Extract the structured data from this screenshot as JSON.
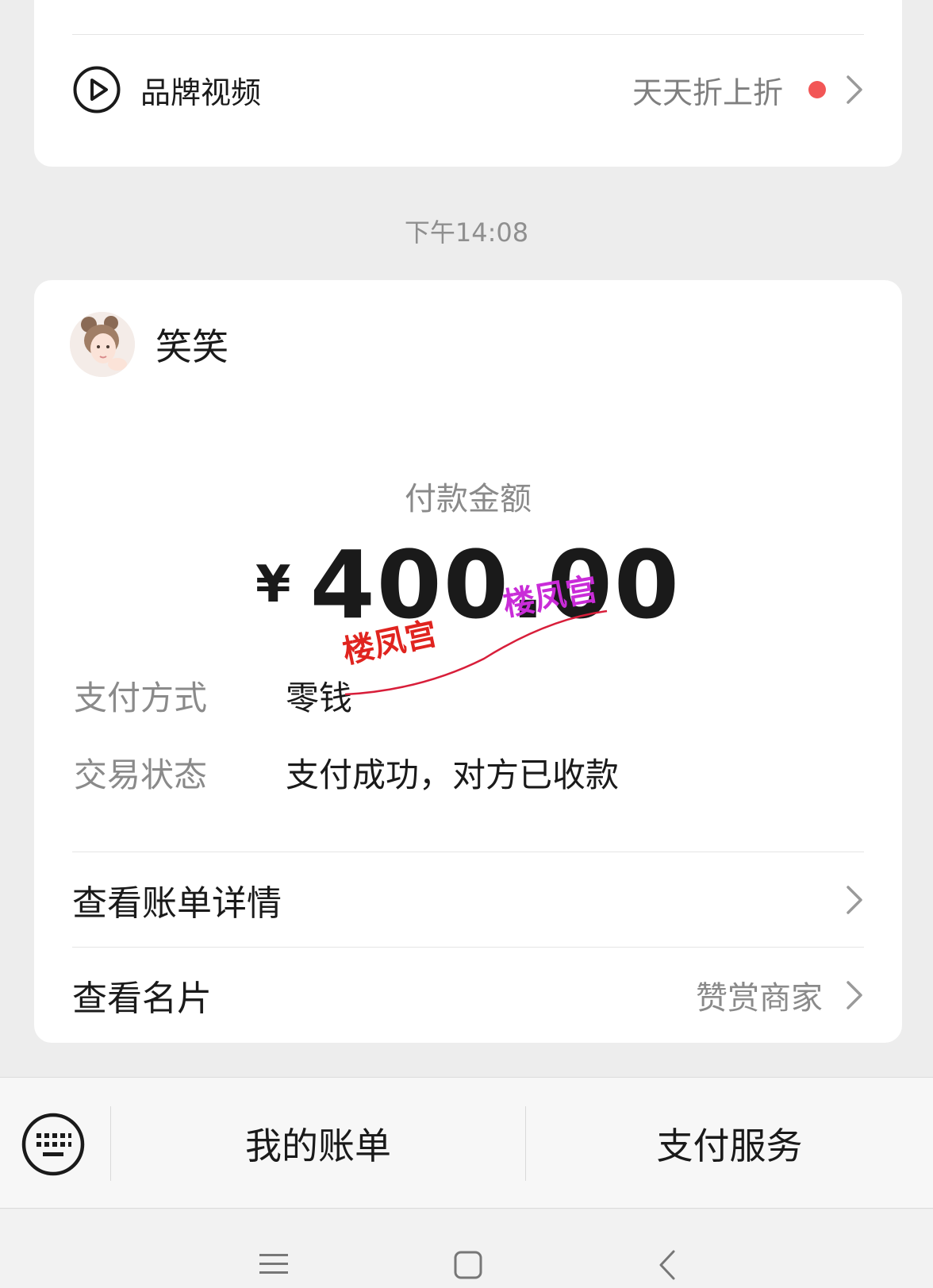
{
  "brand_card": {
    "label": "品牌视频",
    "promo": "天天折上折",
    "dot_color": "#f25656"
  },
  "timestamp": "下午14:08",
  "payment_card": {
    "sender_name": "笑笑",
    "amount_label": "付款金额",
    "currency": "¥",
    "amount": "400.00",
    "method_label": "支付方式",
    "method_value": "零钱",
    "status_label": "交易状态",
    "status_value": "支付成功，对方已收款",
    "bill_details": "查看账单详情",
    "view_card": "查看名片",
    "tip_merchant": "赞赏商家"
  },
  "watermark": {
    "text_left": "楼凤宫",
    "text_right": "楼凤宫"
  },
  "menu_bar": {
    "my_bills": "我的账单",
    "pay_service": "支付服务"
  },
  "icons": {
    "play": "play-circle-icon",
    "chevron": "chevron-right-icon",
    "keyboard": "keyboard-icon",
    "nav_menu": "menu-icon",
    "nav_home": "home-square-icon",
    "nav_back": "back-arrow-icon"
  }
}
